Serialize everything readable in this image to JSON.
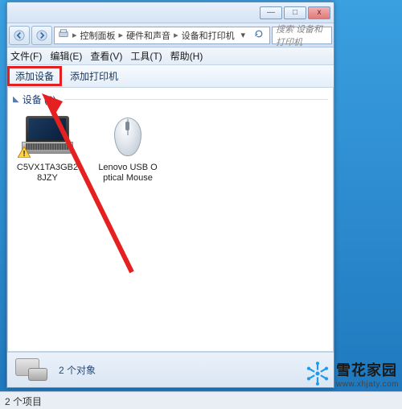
{
  "window": {
    "controls": {
      "min": "—",
      "max": "□",
      "close": "x"
    }
  },
  "nav": {
    "breadcrumb": [
      "控制面板",
      "硬件和声音",
      "设备和打印机"
    ],
    "search_placeholder": "搜索 设备和打印机"
  },
  "menubar": {
    "file": "文件(F)",
    "edit": "编辑(E)",
    "view": "查看(V)",
    "tools": "工具(T)",
    "help": "帮助(H)"
  },
  "toolbar": {
    "add_device": "添加设备",
    "add_printer": "添加打印机"
  },
  "content": {
    "group_label": "设备 (2)",
    "devices": [
      {
        "name": "C5VX1TA3GB28JZY",
        "icon": "laptop",
        "warning": true
      },
      {
        "name": "Lenovo USB Optical Mouse",
        "icon": "mouse",
        "warning": false
      }
    ]
  },
  "details": {
    "summary": "2 个对象"
  },
  "statusbar": {
    "text": "2 个项目"
  },
  "watermark": {
    "brand_cn": "雪花家园",
    "brand_url": "www.xhjaty.com",
    "accent": "#1e9be8"
  }
}
